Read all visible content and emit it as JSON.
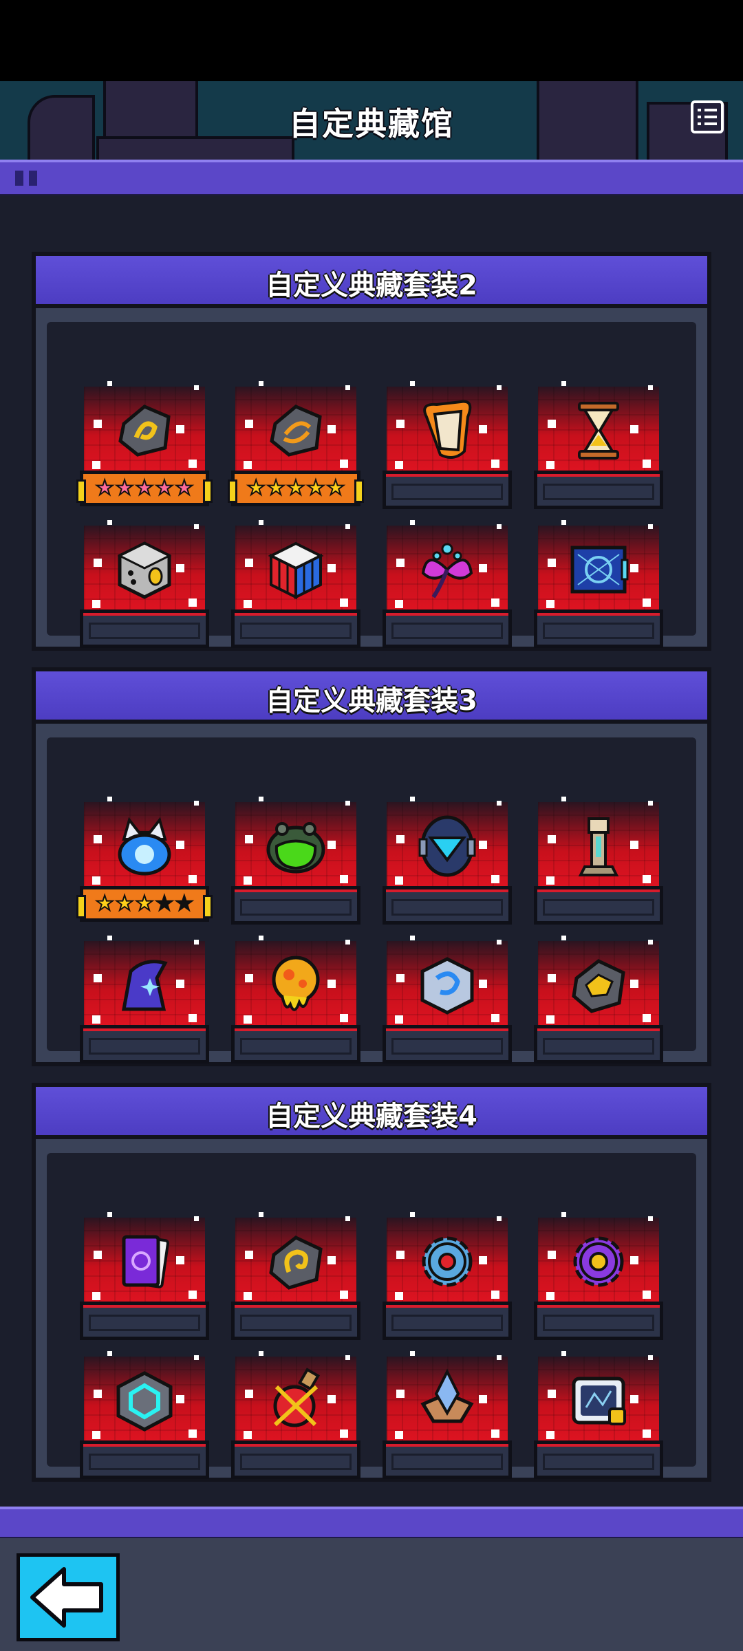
{
  "header": {
    "title": "自定典藏馆",
    "menu_icon": "list-icon"
  },
  "sections": [
    {
      "title": "自定义典藏套装2",
      "items": [
        {
          "icon": "yellow-swirl-rock-icon",
          "stars": 5,
          "star_filled": 5,
          "star_style": "pink"
        },
        {
          "icon": "orange-swirl-rock-icon",
          "stars": 5,
          "star_filled": 5,
          "star_style": "gold"
        },
        {
          "icon": "flaming-scroll-icon"
        },
        {
          "icon": "hourglass-icon"
        },
        {
          "icon": "eye-dice-icon"
        },
        {
          "icon": "rubiks-cube-icon"
        },
        {
          "icon": "magic-flower-icon"
        },
        {
          "icon": "blueprint-icon"
        }
      ]
    },
    {
      "title": "自定义典藏套装3",
      "items": [
        {
          "icon": "robot-cat-orb-icon",
          "stars": 5,
          "star_filled": 3,
          "star_style": "gold"
        },
        {
          "icon": "green-slime-helmet-icon"
        },
        {
          "icon": "blue-visor-helmet-icon"
        },
        {
          "icon": "light-tower-icon"
        },
        {
          "icon": "wizard-hat-icon"
        },
        {
          "icon": "lava-blob-icon"
        },
        {
          "icon": "crystal-cube-icon"
        },
        {
          "icon": "gold-nugget-rock-icon"
        }
      ]
    },
    {
      "title": "自定义典藏套装4",
      "items": [
        {
          "icon": "purple-card-icon"
        },
        {
          "icon": "ear-rock-icon"
        },
        {
          "icon": "blue-gear-icon"
        },
        {
          "icon": "purple-gear-icon"
        },
        {
          "icon": "cyan-hex-cube-icon"
        },
        {
          "icon": "crossed-potion-icon"
        },
        {
          "icon": "crystal-crown-icon"
        },
        {
          "icon": "map-tablet-icon"
        }
      ]
    }
  ],
  "footer": {
    "back_icon": "back-arrow-icon"
  },
  "colors": {
    "accent": "#5b47c8",
    "slot_glow": "#e01422",
    "back_button": "#1ec4f2"
  }
}
